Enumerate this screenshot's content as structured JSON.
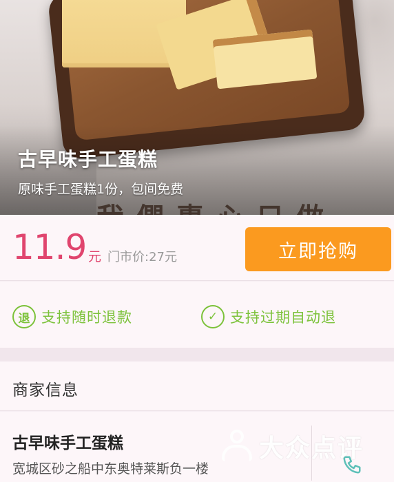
{
  "hero": {
    "title": "古早味手工蛋糕",
    "subtitle": "原味手工蛋糕1份，包间免费",
    "calligraphy": "我們專心只做"
  },
  "price": {
    "value": "11.9",
    "unit": "元",
    "original": "门市价:27元",
    "buy_label": "立即抢购",
    "accent_color": "#e0456e",
    "button_color": "#fb9a1f"
  },
  "guarantees": [
    {
      "icon": "refund-icon",
      "glyph": "退",
      "label": "支持随时退款"
    },
    {
      "icon": "check-circle-icon",
      "glyph": "✓",
      "label": "支持过期自动退"
    }
  ],
  "merchant": {
    "section_title": "商家信息",
    "name": "古早味手工蛋糕",
    "address": "宽城区砂之船中东奥特莱斯负一楼",
    "phone_icon": "phone-icon"
  },
  "watermark": {
    "text": "大众点评"
  }
}
